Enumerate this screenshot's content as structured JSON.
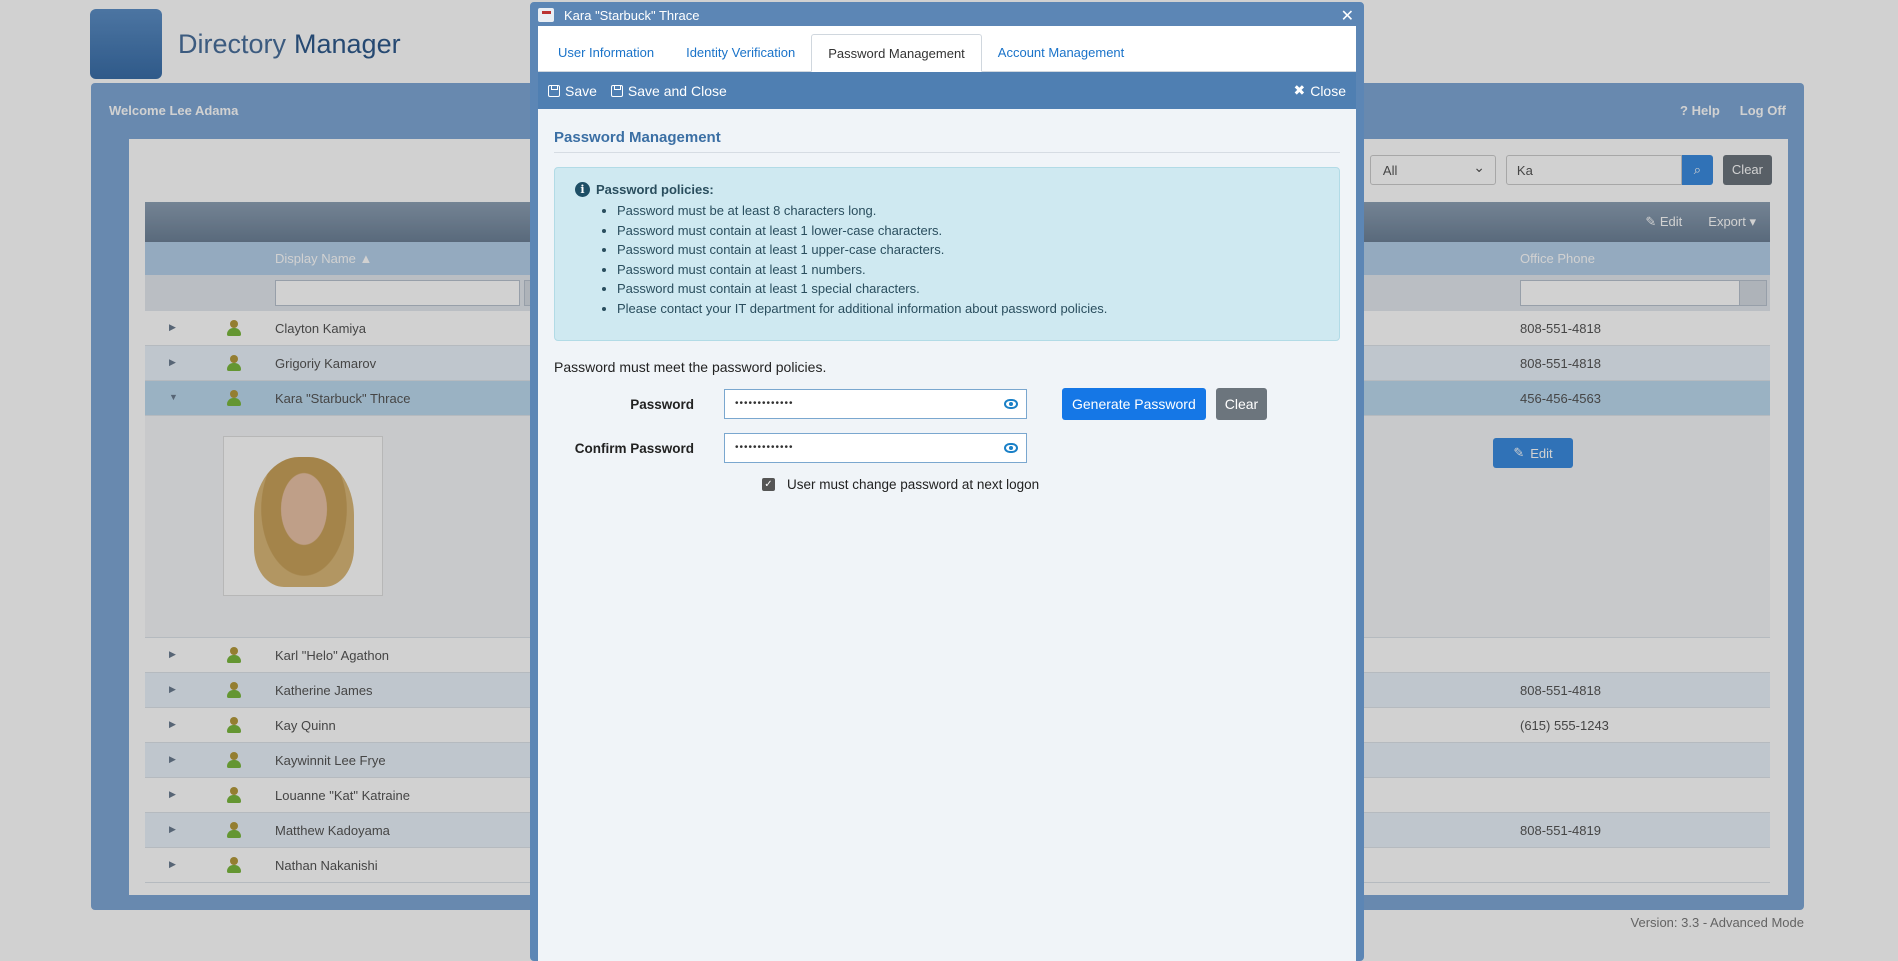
{
  "app": {
    "logo_word1": "Directory",
    "logo_word2": "Manager",
    "welcome": "Welcome Lee Adama",
    "help": "Help",
    "logoff": "Log Off",
    "version": "Version: 3.3 - Advanced Mode"
  },
  "search": {
    "scope": "All",
    "query": "Ka",
    "clear_label": "Clear"
  },
  "grid": {
    "toolbar": {
      "edit_label": "Edit",
      "export_label": "Export"
    },
    "columns": {
      "display_name": "Display Name",
      "office_phone": "Office Phone"
    },
    "rows": [
      {
        "name": "Clayton Kamiya",
        "phone": "808-551-4818"
      },
      {
        "name": "Grigoriy Kamarov",
        "phone": "808-551-4818"
      },
      {
        "name": "Kara \"Starbuck\" Thrace",
        "phone": "456-456-4563"
      },
      {
        "name": "Karl \"Helo\" Agathon",
        "phone": ""
      },
      {
        "name": "Katherine James",
        "phone": "808-551-4818"
      },
      {
        "name": "Kay Quinn",
        "phone": "(615) 555-1243"
      },
      {
        "name": "Kaywinnit Lee Frye",
        "phone": ""
      },
      {
        "name": "Louanne \"Kat\" Katraine",
        "phone": ""
      },
      {
        "name": "Matthew Kadoyama",
        "phone": "808-551-4819"
      },
      {
        "name": "Nathan Nakanishi",
        "phone": ""
      }
    ],
    "detail_edit_label": "Edit"
  },
  "modal": {
    "title": "Kara \"Starbuck\" Thrace",
    "tabs": [
      "User Information",
      "Identity Verification",
      "Password Management",
      "Account Management"
    ],
    "active_tab": "Password Management",
    "toolbar": {
      "save": "Save",
      "save_close": "Save and Close",
      "close": "Close"
    },
    "section_title": "Password Management",
    "policies": {
      "heading": "Password policies:",
      "items": [
        "Password must be at least 8 characters long.",
        "Password must contain at least 1 lower-case characters.",
        "Password must contain at least 1 upper-case characters.",
        "Password must contain at least 1 numbers.",
        "Password must contain at least 1 special characters.",
        "Please contact your IT department for additional information about password policies."
      ]
    },
    "meet_text": "Password must meet the password policies.",
    "password_label": "Password",
    "password_value": "•••••••••••••",
    "confirm_label": "Confirm Password",
    "confirm_value": "•••••••••••••",
    "generate_label": "Generate Password",
    "clear_label": "Clear",
    "must_change_label": "User must change password at next logon",
    "must_change_checked": true
  }
}
